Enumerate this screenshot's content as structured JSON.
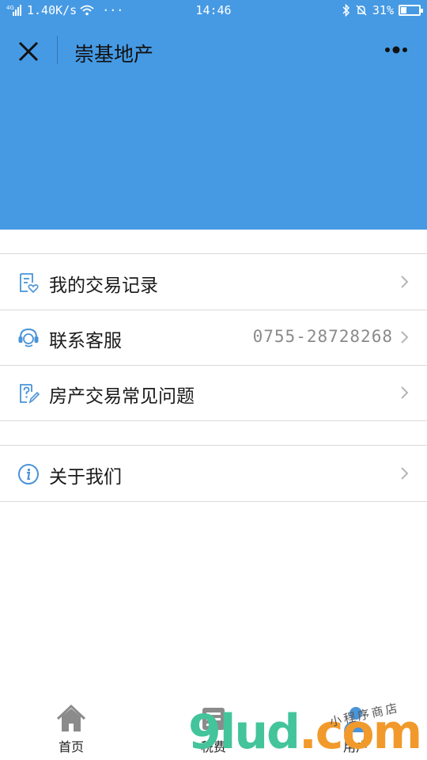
{
  "status_bar": {
    "network": "4G",
    "speed": "1.40K/s",
    "dots": "···",
    "time": "14:46",
    "battery": "31%",
    "battery_level": 0.31
  },
  "header": {
    "title": "崇基地产",
    "close_icon": "close-icon",
    "more_icon": "more-options-icon",
    "color": "#469ae4"
  },
  "menu": {
    "group1": [
      {
        "label": "我的交易记录",
        "value": "",
        "icon": "transaction-record-icon"
      },
      {
        "label": "联系客服",
        "value": "0755-28728268",
        "icon": "customer-service-icon"
      },
      {
        "label": "房产交易常见问题",
        "value": "",
        "icon": "faq-icon"
      }
    ],
    "group2": [
      {
        "label": "关于我们",
        "value": "",
        "icon": "info-icon"
      }
    ]
  },
  "tabbar": {
    "tabs": [
      {
        "label": "首页",
        "icon": "home-icon"
      },
      {
        "label": "税费",
        "icon": "tax-icon"
      },
      {
        "label": "用户",
        "icon": "user-icon"
      }
    ]
  },
  "watermark": {
    "main": "9lud",
    "dot": ".",
    "com": "com",
    "sub": "小程序商店"
  },
  "colors": {
    "accent": "#469ae4",
    "icon_blue": "#4a94d8",
    "divider": "#d9d9d9"
  }
}
